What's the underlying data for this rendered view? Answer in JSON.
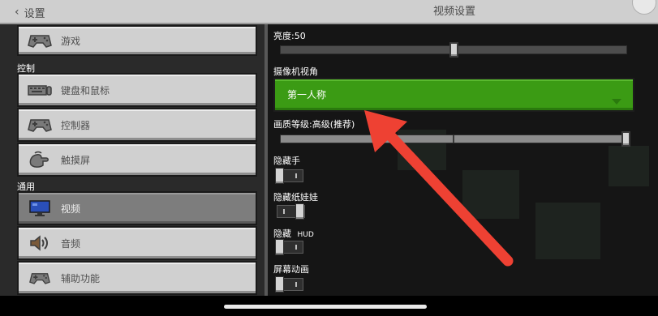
{
  "header": {
    "back_label": "设置",
    "title": "视频设置"
  },
  "menu": {
    "item_game": "游戏",
    "section_controls": "控制",
    "item_keyboard": "键盘和鼠标",
    "item_controller": "控制器",
    "item_touch": "触摸屏",
    "section_general": "通用",
    "item_video": "视频",
    "item_audio": "音频",
    "item_accessibility": "辅助功能",
    "selected_item": "视频"
  },
  "settings": {
    "brightness": {
      "label": "亮度:50",
      "value": 50,
      "min": 0,
      "max": 100
    },
    "camera": {
      "label": "摄像机视角",
      "value": "第一人称"
    },
    "quality": {
      "label": "画质等级:高级(推荐)",
      "level_fraction": 1.0
    },
    "hide_hand": {
      "label": "隐藏手",
      "on": false
    },
    "hide_paperdoll": {
      "label": "隐藏纸娃娃",
      "on": true
    },
    "hide_hud": {
      "label": "隐藏",
      "label_suffix": "HUD",
      "on": false
    },
    "screen_animation": {
      "label": "屏幕动画",
      "on": false
    }
  },
  "icons": {
    "back": "chevron-left-icon",
    "game": "gamepad-icon",
    "keyboard": "keyboard-icon",
    "controller": "gamepad-icon",
    "touch": "touch-hand-icon",
    "video": "monitor-icon",
    "audio": "speaker-icon",
    "accessibility": "gamepad-icon",
    "dropdown": "caret-down-icon"
  },
  "colors": {
    "title_bar": "#cfcfcf",
    "dropdown_green": "#3b9b14",
    "annotation_arrow": "#ee4133",
    "menu_button": "#d0d0d0",
    "menu_selected": "#7d7d7d"
  }
}
